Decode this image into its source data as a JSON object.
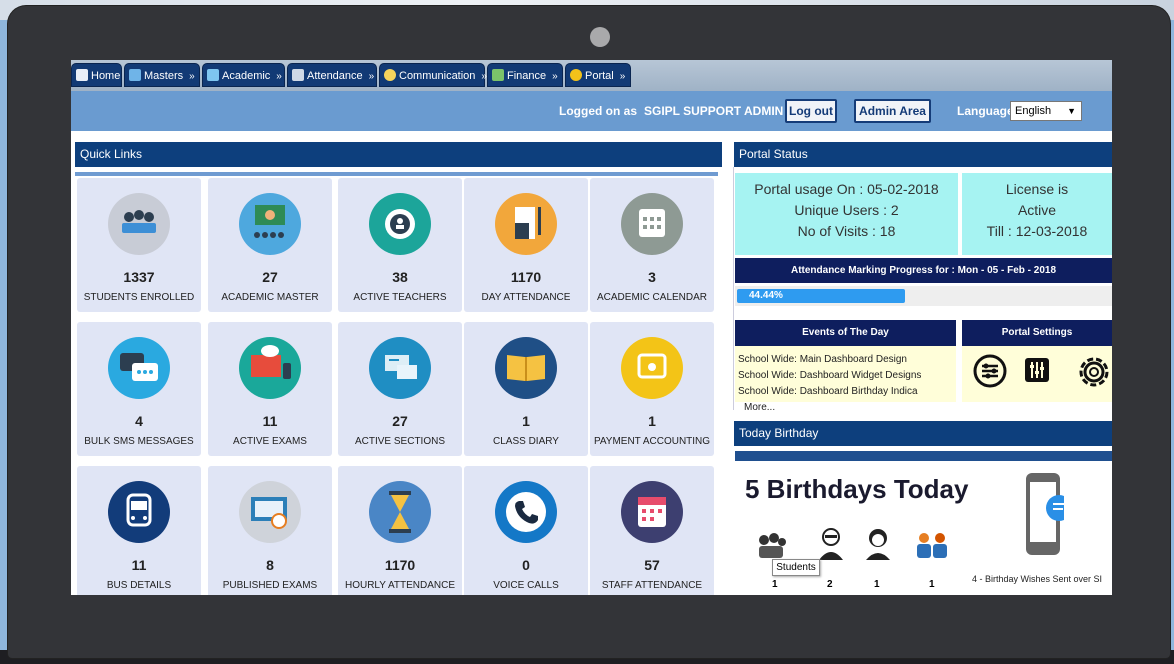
{
  "tabs": [
    {
      "label": "Home",
      "arrow": "",
      "icon": "home-icon"
    },
    {
      "label": "Masters",
      "arrow": "»",
      "icon": "masters-icon"
    },
    {
      "label": "Academic",
      "arrow": "»",
      "icon": "academic-icon"
    },
    {
      "label": "Attendance",
      "arrow": "»",
      "icon": "attendance-icon"
    },
    {
      "label": "Communication",
      "arrow": "»",
      "icon": "communication-icon"
    },
    {
      "label": "Finance",
      "arrow": "»",
      "icon": "finance-icon"
    },
    {
      "label": "Portal",
      "arrow": "»",
      "icon": "portal-icon"
    }
  ],
  "infobar": {
    "logged_label": "Logged on as",
    "user": "SGIPL SUPPORT ADMIN",
    "logout": "Log out",
    "admin_area": "Admin Area",
    "language_label": "Language",
    "language_value": "English"
  },
  "quick_links": {
    "title": "Quick Links",
    "cards": [
      {
        "value": "1337",
        "label": "STUDENTS ENROLLED",
        "icon": "students-icon",
        "color": "#c8ccd6"
      },
      {
        "value": "27",
        "label": "ACADEMIC MASTER",
        "icon": "classroom-icon",
        "color": "#4ea8de"
      },
      {
        "value": "38",
        "label": "ACTIVE TEACHERS",
        "icon": "teacher-icon",
        "color": "#1ca59a"
      },
      {
        "value": "1170",
        "label": "DAY ATTENDANCE",
        "icon": "document-icon",
        "color": "#f2a73b"
      },
      {
        "value": "3",
        "label": "ACADEMIC CALENDAR",
        "icon": "calendar-icon",
        "color": "#8e9a94"
      },
      {
        "value": "4",
        "label": "BULK SMS MESSAGES",
        "icon": "sms-icon",
        "color": "#2aa9e0"
      },
      {
        "value": "11",
        "label": "ACTIVE EXAMS",
        "icon": "exam-icon",
        "color": "#1aa89a"
      },
      {
        "value": "27",
        "label": "ACTIVE SECTIONS",
        "icon": "sections-icon",
        "color": "#1f8ec3"
      },
      {
        "value": "1",
        "label": "CLASS DIARY",
        "icon": "diary-icon",
        "color": "#1f4f86"
      },
      {
        "value": "1",
        "label": "PAYMENT ACCOUNTING",
        "icon": "payment-icon",
        "color": "#f3c417"
      },
      {
        "value": "11",
        "label": "BUS DETAILS",
        "icon": "bus-icon",
        "color": "#123c7a"
      },
      {
        "value": "8",
        "label": "PUBLISHED EXAMS",
        "icon": "published-exams-icon",
        "color": "#cfd3da"
      },
      {
        "value": "1170",
        "label": "HOURLY ATTENDANCE",
        "icon": "hourglass-icon",
        "color": "#4a86c6"
      },
      {
        "value": "0",
        "label": "VOICE CALLS",
        "icon": "phone-icon",
        "color": "#1478c7"
      },
      {
        "value": "57",
        "label": "STAFF ATTENDANCE",
        "icon": "staff-calendar-icon",
        "color": "#3d3f70"
      }
    ]
  },
  "portal_status": {
    "title": "Portal Status",
    "usage": "Portal usage On : 05-02-2018",
    "unique_users": "Unique Users : 2",
    "visits": "No of Visits : 18",
    "license_line1": "License is",
    "license_line2": "Active",
    "license_till": "Till : 12-03-2018",
    "attendance_title": "Attendance Marking Progress for : Mon - 05 - Feb - 2018",
    "progress_label": "44.44%",
    "progress_value": 44.44,
    "events_title": "Events of The Day",
    "events": [
      "School Wide: Main Dashboard Design",
      "School Wide: Dashboard Widget Designs",
      "School Wide: Dashboard Birthday Indica"
    ],
    "more": "More...",
    "settings_title": "Portal Settings"
  },
  "birthday": {
    "title": "Today Birthday",
    "headline": "5 Birthdays Today",
    "groups": [
      {
        "count": "1",
        "icon": "students-group-icon"
      },
      {
        "count": "2",
        "icon": "teacher-man-icon"
      },
      {
        "count": "1",
        "icon": "woman-icon"
      },
      {
        "count": "1",
        "icon": "staff-group-icon"
      }
    ],
    "tooltip": "Students",
    "wishes": "4 - Birthday Wishes Sent over SI"
  },
  "colors": {
    "tab": "#123a75",
    "infobar": "#6a9bd0",
    "panel_head": "#0d3f7d",
    "card": "#e0e5f5",
    "progress": "#2e9bf0"
  }
}
